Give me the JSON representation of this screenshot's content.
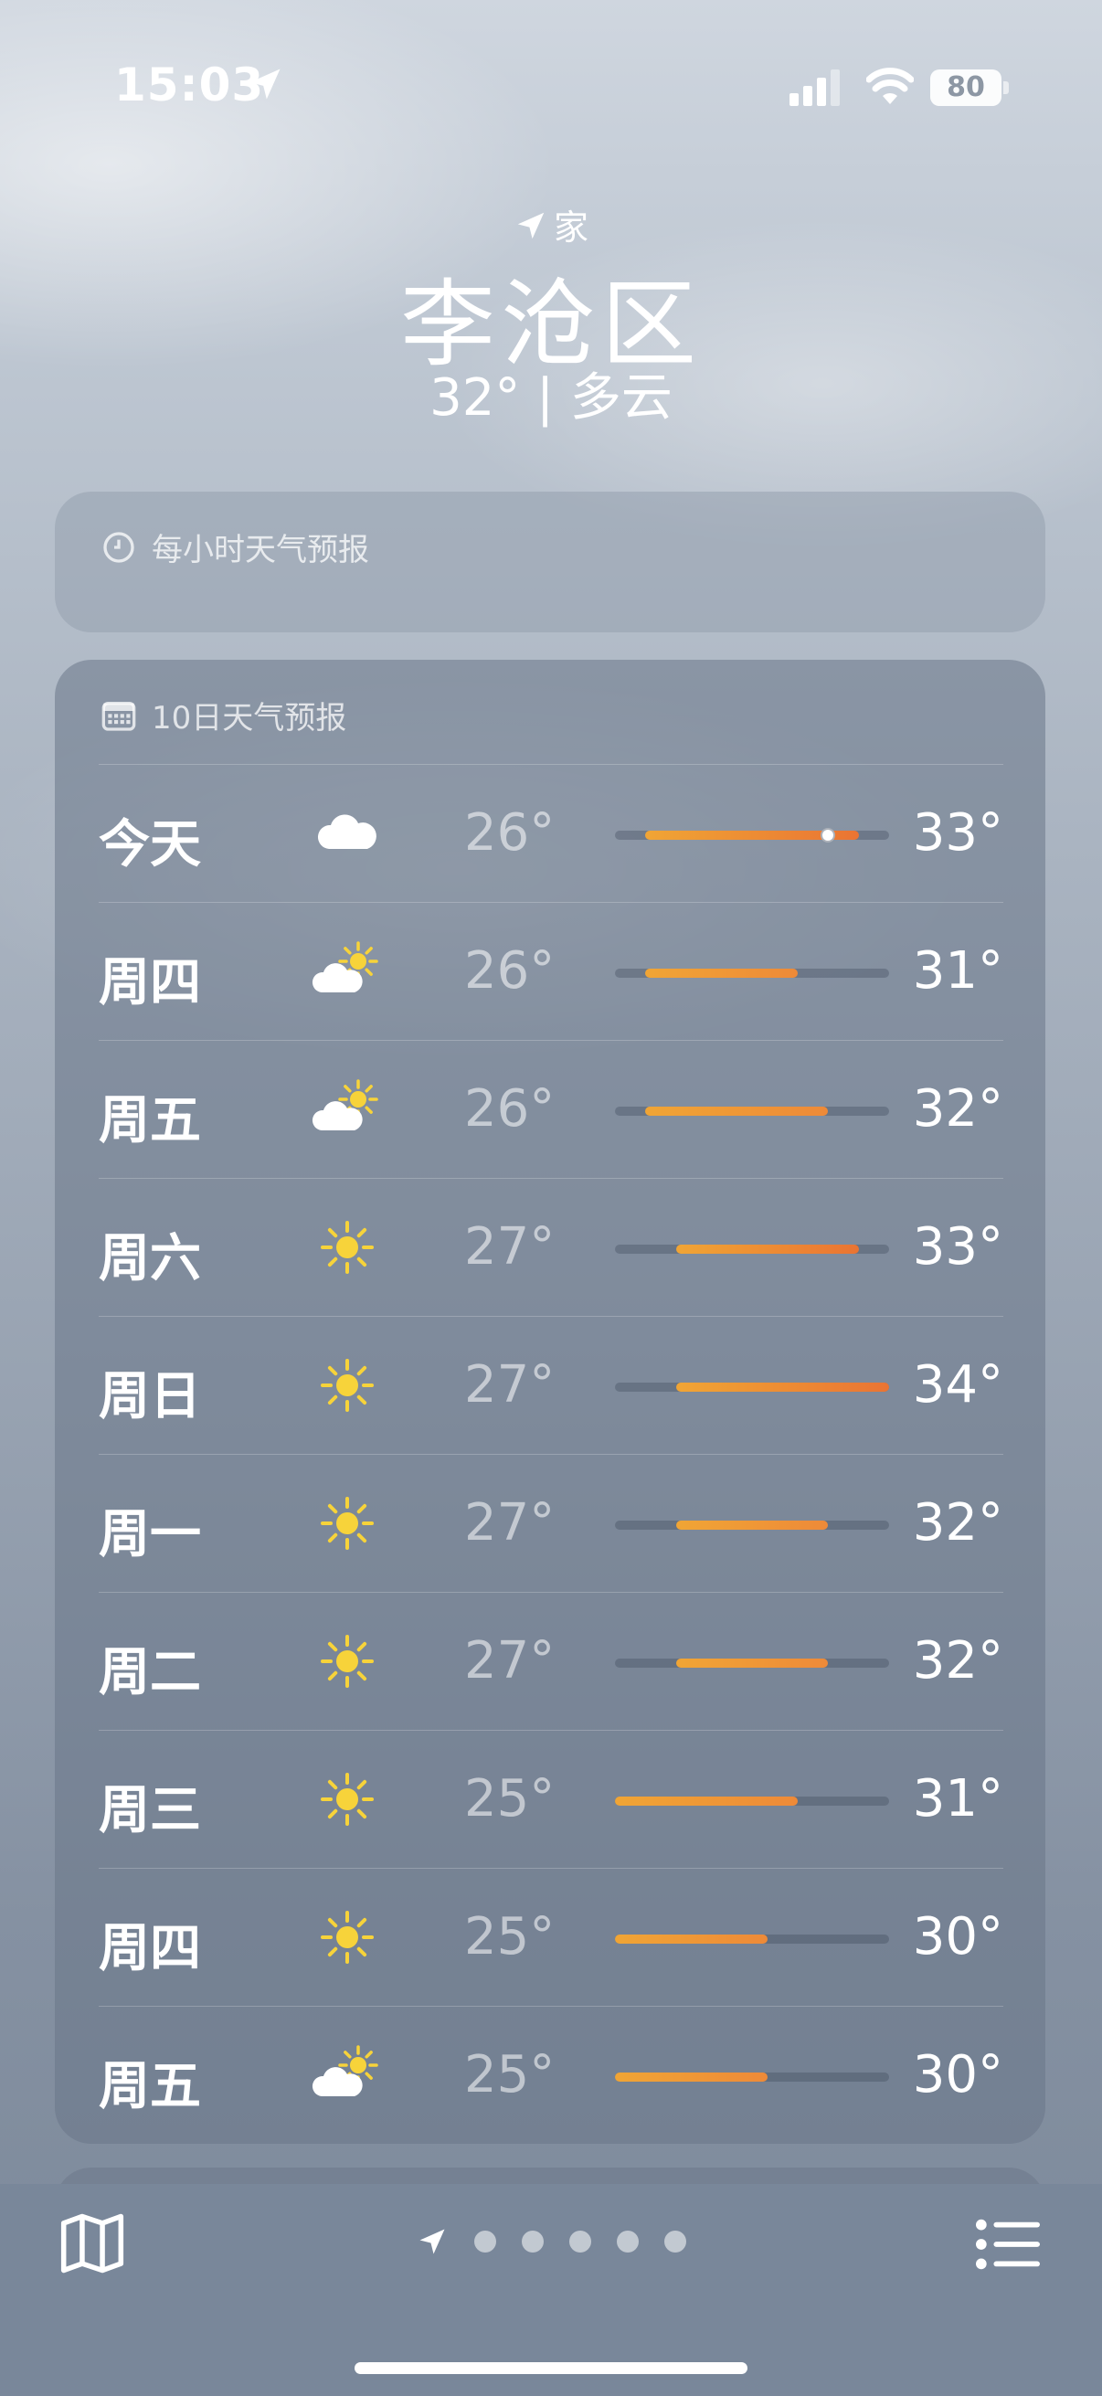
{
  "status_bar": {
    "time": "15:03",
    "battery": "80"
  },
  "header": {
    "home_label": "家",
    "city": "李沧区",
    "current": "32° | 多云"
  },
  "hourly": {
    "title": "每小时天气预报"
  },
  "daily": {
    "title": "10日天气预报",
    "rows": [
      {
        "day": "今天",
        "icon": "cloud-icon",
        "lo": "26°",
        "hi": "33°",
        "lo_val": 26,
        "hi_val": 33,
        "current_val": 32
      },
      {
        "day": "周四",
        "icon": "partly-sunny-icon",
        "lo": "26°",
        "hi": "31°",
        "lo_val": 26,
        "hi_val": 31
      },
      {
        "day": "周五",
        "icon": "partly-sunny-icon",
        "lo": "26°",
        "hi": "32°",
        "lo_val": 26,
        "hi_val": 32
      },
      {
        "day": "周六",
        "icon": "sun-icon",
        "lo": "27°",
        "hi": "33°",
        "lo_val": 27,
        "hi_val": 33
      },
      {
        "day": "周日",
        "icon": "sun-icon",
        "lo": "27°",
        "hi": "34°",
        "lo_val": 27,
        "hi_val": 34
      },
      {
        "day": "周一",
        "icon": "sun-icon",
        "lo": "27°",
        "hi": "32°",
        "lo_val": 27,
        "hi_val": 32
      },
      {
        "day": "周二",
        "icon": "sun-icon",
        "lo": "27°",
        "hi": "32°",
        "lo_val": 27,
        "hi_val": 32
      },
      {
        "day": "周三",
        "icon": "sun-icon",
        "lo": "25°",
        "hi": "31°",
        "lo_val": 25,
        "hi_val": 31
      },
      {
        "day": "周四",
        "icon": "sun-icon",
        "lo": "25°",
        "hi": "30°",
        "lo_val": 25,
        "hi_val": 30
      },
      {
        "day": "周五",
        "icon": "partly-sunny-icon",
        "lo": "25°",
        "hi": "30°",
        "lo_val": 25,
        "hi_val": 30
      }
    ]
  },
  "colors": {
    "bar_cool": "#f0a535",
    "bar_warm": "#ea7433",
    "sun": "#f7d33a"
  }
}
